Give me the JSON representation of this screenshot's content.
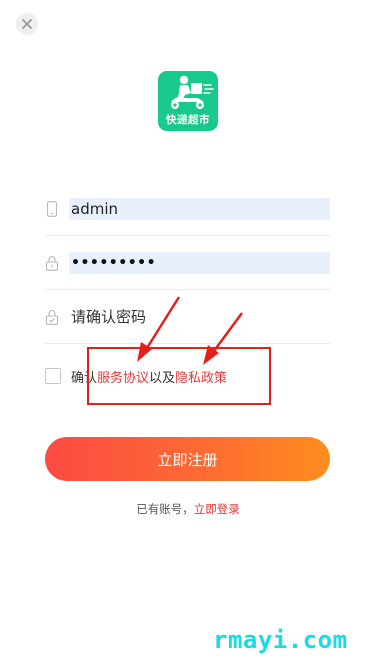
{
  "app": {
    "logo_text": "快递超市",
    "brand_color": "#17c98a",
    "accent_color": "#e8393a"
  },
  "form": {
    "username_value": "admin",
    "password_mask": "•••••••••",
    "confirm_placeholder": "请确认密码"
  },
  "agreement": {
    "prefix": "确认",
    "service_link": "服务协议",
    "middle": "以及",
    "privacy_link": "隐私政策"
  },
  "register_button": "立即注册",
  "login_prompt": {
    "text": "已有账号，",
    "link": "立即登录"
  },
  "watermark": "rmayi.com",
  "icons": {
    "close": "close-icon",
    "phone": "phone-icon",
    "lock": "lock-icon",
    "shield": "shield-check-icon"
  }
}
